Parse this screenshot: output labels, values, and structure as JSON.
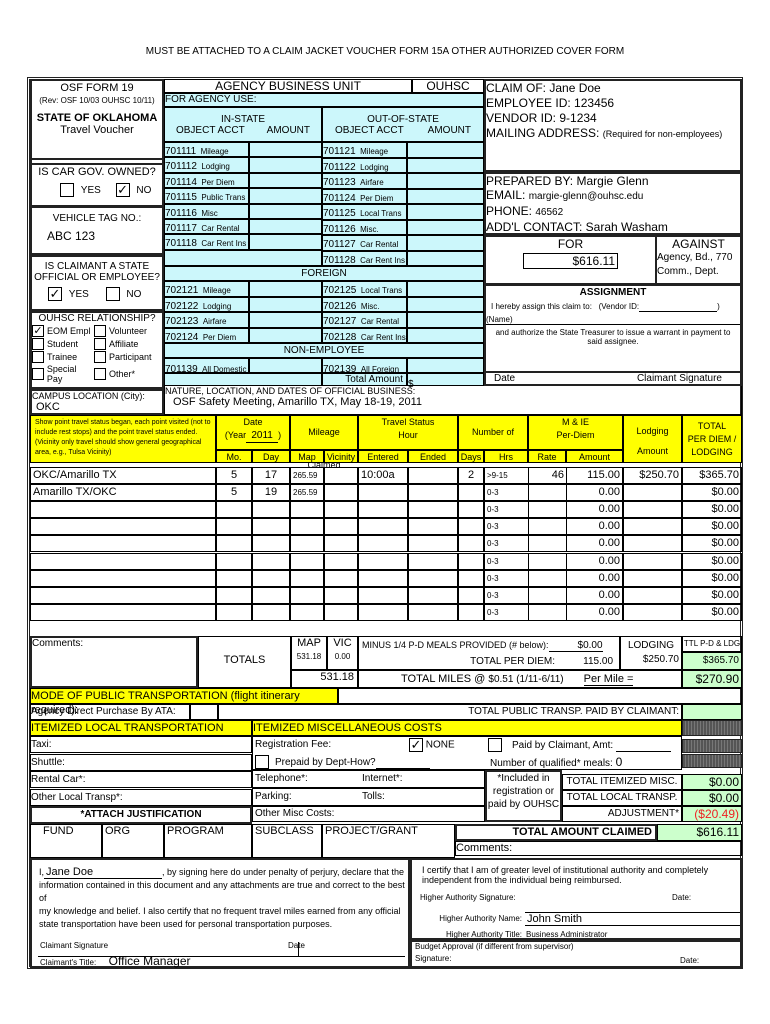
{
  "header_note": "MUST BE ATTACHED TO A CLAIM JACKET VOUCHER FORM 15A OTHER AUTHORIZED COVER FORM",
  "form": {
    "name": "OSF FORM 19",
    "revision": "(Rev: OSF 10/03 OUHSC 10/11)",
    "state": "STATE OF OKLAHOMA",
    "title": "Travel Voucher"
  },
  "car_gov_owned": {
    "question": "IS CAR GOV. OWNED?",
    "yes_label": "YES",
    "no_label": "NO",
    "yes_checked": false,
    "no_checked": true,
    "check_glyph": "✓"
  },
  "vehicle_tag": {
    "label": "VEHICLE TAG NO.:",
    "value": "ABC 123"
  },
  "state_official": {
    "question_line1": "IS CLAIMANT A STATE",
    "question_line2": "OFFICIAL OR EMPLOYEE?",
    "yes_label": "YES",
    "no_label": "NO",
    "yes_checked": true,
    "no_checked": false
  },
  "relationship": {
    "title": "OUHSC RELATIONSHIP?",
    "options": [
      {
        "label": "EOM Empl",
        "checked": true
      },
      {
        "label": "Volunteer",
        "checked": false
      },
      {
        "label": "Student",
        "checked": false
      },
      {
        "label": "Affiliate",
        "checked": false
      },
      {
        "label": "Trainee",
        "checked": false
      },
      {
        "label": "Participant",
        "checked": false
      },
      {
        "label": "Special Pay",
        "checked": false
      },
      {
        "label": "Other*",
        "checked": false
      }
    ]
  },
  "campus": {
    "label": "CAMPUS LOCATION (City):",
    "value": "OKC"
  },
  "agency": {
    "business_unit_label": "AGENCY BUSINESS UNIT",
    "business_unit_value": "OUHSC",
    "for_agency_use": "FOR AGENCY USE:",
    "instate_label": "IN-STATE",
    "outstate_label": "OUT-OF-STATE",
    "object_acct_label": "OBJECT ACCT",
    "amount_label": "AMOUNT",
    "instate_accounts": [
      {
        "code": "701111",
        "name": "Mileage"
      },
      {
        "code": "701112",
        "name": "Lodging"
      },
      {
        "code": "701114",
        "name": "Per Diem"
      },
      {
        "code": "701115",
        "name": "Public Trans"
      },
      {
        "code": "701116",
        "name": "Misc"
      },
      {
        "code": "701117",
        "name": "Car Rental"
      },
      {
        "code": "701118",
        "name": "Car Rent Ins"
      }
    ],
    "outstate_accounts": [
      {
        "code": "701121",
        "name": "Mileage"
      },
      {
        "code": "701122",
        "name": "Lodging"
      },
      {
        "code": "701123",
        "name": "Airfare"
      },
      {
        "code": "701124",
        "name": "Per Diem"
      },
      {
        "code": "701125",
        "name": "Local Trans"
      },
      {
        "code": "701126",
        "name": "Misc."
      },
      {
        "code": "701127",
        "name": "Car Rental"
      },
      {
        "code": "701128",
        "name": "Car Rent Ins"
      }
    ],
    "foreign_label": "FOREIGN",
    "foreign_left": [
      {
        "code": "702121",
        "name": "Mileage"
      },
      {
        "code": "702122",
        "name": "Lodging"
      },
      {
        "code": "702123",
        "name": "Airfare"
      },
      {
        "code": "702124",
        "name": "Per Diem"
      }
    ],
    "foreign_right": [
      {
        "code": "702125",
        "name": "Local Trans"
      },
      {
        "code": "702126",
        "name": "Misc."
      },
      {
        "code": "702127",
        "name": "Car Rental"
      },
      {
        "code": "702128",
        "name": "Car Rent Ins"
      }
    ],
    "non_employee_label": "NON-EMPLOYEE",
    "non_employee_left": {
      "code": "701139",
      "name": "All Domestic"
    },
    "non_employee_right": {
      "code": "702139",
      "name": "All Foreign"
    },
    "total_amount_label": "Total Amount",
    "total_amount_currency": "$"
  },
  "claim": {
    "claim_of_label": "CLAIM OF:",
    "claim_of": "Jane Doe",
    "employee_id_label": "EMPLOYEE ID:",
    "employee_id": "123456",
    "vendor_id_label": "VENDOR ID:",
    "vendor_id": "9-1234",
    "mailing_label": "MAILING ADDRESS:",
    "mailing_note": "(Required for non-employees)",
    "prepared_by_label": "PREPARED BY:",
    "prepared_by": "Margie Glenn",
    "email_label": "EMAIL:",
    "email": "margie-glenn@ouhsc.edu",
    "phone_label": "PHONE:",
    "phone": "46562",
    "contact_label": "ADD'L CONTACT:",
    "contact": "Sarah Washam",
    "for_label": "FOR",
    "against_label": "AGAINST",
    "for_amount": "$616.11",
    "against_line1": "Agency, Bd., 770",
    "against_line2": "Comm., Dept."
  },
  "assignment": {
    "title": "ASSIGNMENT",
    "assign_text": "I hereby assign this claim to:",
    "vendor_id_label": "(Vendor ID:",
    "vendor_id_close": ")",
    "name_label": "(Name)",
    "authorize_text": "and authorize the State Treasurer to issue a warrant in payment to said assignee.",
    "date_label": "Date",
    "signature_label": "Claimant Signature"
  },
  "business": {
    "label": "NATURE, LOCATION, AND DATES OF OFFICIAL BUSINESS:",
    "value": "OSF Safety Meeting, Amarillo TX, May 18-19, 2011"
  },
  "travel_table": {
    "instructions": "Show point travel status began, each point visited (not to include rest stops) and the point travel status ended. (Vicinity only travel should show general geographical area, e.g., Tulsa Vicinity)",
    "date_label": "Date",
    "year_prefix": "(Year",
    "year": "2011",
    "year_suffix": ")",
    "mo_label": "Mo.",
    "day_label": "Day",
    "mileage_label": "Mileage Claimed",
    "map_label": "Map",
    "vicinity_label": "Vicinity",
    "travel_status_label": "Travel Status",
    "hour_label": "Hour",
    "entered_label": "Entered",
    "ended_label": "Ended",
    "number_of_label": "Number of",
    "days_label": "Days",
    "hrs_label": "Hrs",
    "mie_label": "M & IE",
    "perdiem_label": "Per-Diem",
    "rate_label": "Rate",
    "amount_label": "Amount",
    "lodging_label": "Lodging",
    "lodging_amount_label": "Amount",
    "total_label_1": "TOTAL",
    "total_label_2": "PER DIEM /",
    "total_label_3": "LODGING",
    "rows": [
      {
        "location": "OKC/Amarillo TX",
        "mo": "5",
        "day": "17",
        "map": "265.59",
        "vicinity": "",
        "entered": "10:00a",
        "ended": "",
        "days": "2",
        "hrs": ">9-15",
        "rate": "46",
        "amount": "115.00",
        "lodging": "$250.70",
        "total": "$365.70"
      },
      {
        "location": "Amarillo TX/OKC",
        "mo": "5",
        "day": "19",
        "map": "265.59",
        "vicinity": "",
        "entered": "",
        "ended": "",
        "days": "",
        "hrs": "0-3",
        "rate": "",
        "amount": "0.00",
        "lodging": "",
        "total": "$0.00"
      },
      {
        "location": "",
        "mo": "",
        "day": "",
        "map": "",
        "vicinity": "",
        "entered": "",
        "ended": "",
        "days": "",
        "hrs": "0-3",
        "rate": "",
        "amount": "0.00",
        "lodging": "",
        "total": "$0.00"
      },
      {
        "location": "",
        "mo": "",
        "day": "",
        "map": "",
        "vicinity": "",
        "entered": "",
        "ended": "",
        "days": "",
        "hrs": "0-3",
        "rate": "",
        "amount": "0.00",
        "lodging": "",
        "total": "$0.00"
      },
      {
        "location": "",
        "mo": "",
        "day": "",
        "map": "",
        "vicinity": "",
        "entered": "",
        "ended": "",
        "days": "",
        "hrs": "0-3",
        "rate": "",
        "amount": "0.00",
        "lodging": "",
        "total": "$0.00"
      },
      {
        "location": "",
        "mo": "",
        "day": "",
        "map": "",
        "vicinity": "",
        "entered": "",
        "ended": "",
        "days": "",
        "hrs": "0-3",
        "rate": "",
        "amount": "0.00",
        "lodging": "",
        "total": "$0.00"
      },
      {
        "location": "",
        "mo": "",
        "day": "",
        "map": "",
        "vicinity": "",
        "entered": "",
        "ended": "",
        "days": "",
        "hrs": "0-3",
        "rate": "",
        "amount": "0.00",
        "lodging": "",
        "total": "$0.00"
      },
      {
        "location": "",
        "mo": "",
        "day": "",
        "map": "",
        "vicinity": "",
        "entered": "",
        "ended": "",
        "days": "",
        "hrs": "0-3",
        "rate": "",
        "amount": "0.00",
        "lodging": "",
        "total": "$0.00"
      },
      {
        "location": "",
        "mo": "",
        "day": "",
        "map": "",
        "vicinity": "",
        "entered": "",
        "ended": "",
        "days": "",
        "hrs": "0-3",
        "rate": "",
        "amount": "0.00",
        "lodging": "",
        "total": "$0.00"
      }
    ]
  },
  "totals": {
    "comments_label": "Comments:",
    "totals_label": "TOTALS",
    "map_label": "MAP",
    "vic_label": "VIC",
    "map_total": "531.18",
    "vic_total": "0.00",
    "miles_total": "531.18",
    "minus_meals_label": "MINUS 1/4 P-D MEALS PROVIDED (# below):",
    "minus_meals_value": "$0.00",
    "lodging_label": "LODGING",
    "ttl_label": "TTL P-D & LDG",
    "total_perdiem_label": "TOTAL PER DIEM:",
    "total_perdiem_value": "115.00",
    "lodging_value": "$250.70",
    "ttl_value": "$365.70",
    "total_miles_label": "TOTAL MILES @",
    "mileage_rate": "$0.51 (1/11-6/11)",
    "per_mile_label": "Per Mile =",
    "mileage_value": "$270.90"
  },
  "public_transport": {
    "mode_label": "MODE OF PUBLIC TRANSPORTATION (flight itinerary required):",
    "mode_value": "",
    "ata_label": "Agency Direct Purchase By ATA:",
    "ata_value": "",
    "total_label": "TOTAL PUBLIC TRANSP. PAID BY CLAIMANT:",
    "total_value": ""
  },
  "local_transport": {
    "title": "ITEMIZED LOCAL TRANSPORTATION",
    "items": [
      "Taxi:",
      "Shuttle:",
      "Rental Car*:",
      "Other Local Transp*:"
    ],
    "justification": "*ATTACH JUSTIFICATION"
  },
  "misc_costs": {
    "title": "ITEMIZED MISCELLANEOUS COSTS",
    "registration_label": "Registration Fee:",
    "none_label": "NONE",
    "none_checked": true,
    "paid_claimant_label": "Paid by Claimant, Amt:",
    "paid_claimant_checked": false,
    "prepaid_label": "Prepaid by Dept-How?",
    "prepaid_checked": false,
    "qualified_meals_label": "Number of qualified* meals:",
    "qualified_meals_value": "0",
    "telephone_label": "Telephone*:",
    "internet_label": "Internet*:",
    "parking_label": "Parking:",
    "tolls_label": "Tolls:",
    "other_label": "Other Misc Costs:",
    "included_note_1": "*Included in",
    "included_note_2": "registration or",
    "included_note_3": "paid by OUHSC",
    "total_misc_label": "TOTAL ITEMIZED MISC.",
    "total_misc_value": "$0.00",
    "total_local_label": "TOTAL LOCAL TRANSP.",
    "total_local_value": "$0.00",
    "adjustment_label": "ADJUSTMENT*",
    "adjustment_value": "($20.49)"
  },
  "funding": {
    "columns": [
      "FUND",
      "ORG",
      "PROGRAM",
      "SUBCLASS",
      "PROJECT/GRANT"
    ],
    "total_claimed_label": "TOTAL AMOUNT CLAIMED",
    "total_claimed_value": "$616.11",
    "comments_label": "Comments:"
  },
  "declaration": {
    "prefix": "I,",
    "name": "Jane Doe",
    "text_1": ", by signing here do under penalty of perjury, declare that the",
    "text_2": "information contained in this document and any attachments are true and correct to the best of",
    "text_3": "my knowledge and belief.  I also certify that no frequent travel miles earned from any official",
    "text_4": "state transportation have been used for personal transportation purposes.",
    "signature_label": "Claimant Signature",
    "date_label": "Date",
    "title_label": "Claimant's Title:",
    "title_value": "Office Manager"
  },
  "authority": {
    "certify_1": "I certify that I am of greater level of institutional authority and completely",
    "certify_2": "independent from the individual being reimbursed.",
    "signature_label": "Higher Authority Signature:",
    "date_label": "Date:",
    "name_label": "Higher Authority Name:",
    "name_value": "John Smith",
    "title_label": "Higher Authority Title:",
    "title_value": "Business Administrator",
    "budget_label": "Budget Approval (if different from supervisor)",
    "budget_signature_label": "Signature:",
    "budget_date_label": "Date:"
  }
}
